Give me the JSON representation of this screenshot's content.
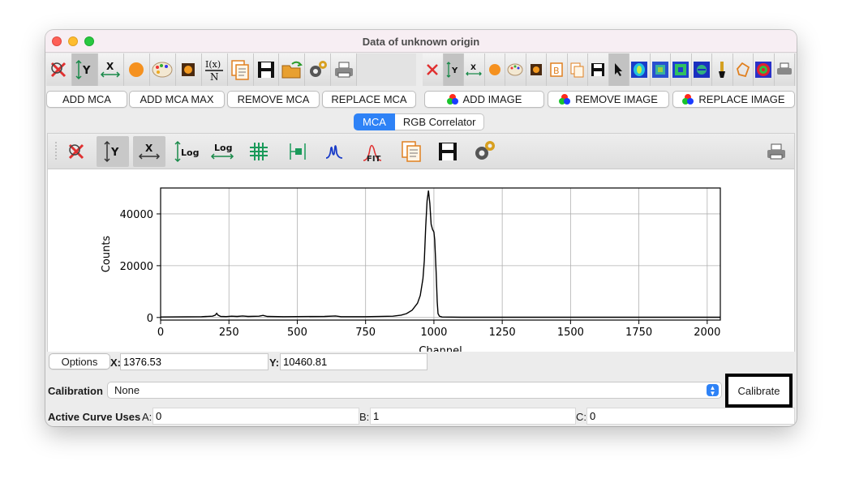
{
  "window": {
    "title": "Data of unknown origin"
  },
  "toolbar_main": {
    "icons": [
      "reset-zoom-icon",
      "autoscale-y-icon",
      "autoscale-x-icon",
      "point-marker-icon",
      "color-palette-icon",
      "image-save-icon",
      "normalize-icon",
      "copy-icon",
      "save-icon",
      "open-folder-icon",
      "settings-icon",
      "print-icon"
    ],
    "normalize_top": "I(x)",
    "normalize_bottom": "N"
  },
  "toolbar_image": {
    "icons": [
      "reset-zoom-icon",
      "autoscale-y-icon",
      "autoscale-x-icon",
      "point-marker-icon",
      "color-palette-icon",
      "image-save-icon",
      "bookmark-icon",
      "copy-icon",
      "save-icon",
      "pointer-icon",
      "colormap-1-icon",
      "colormap-2-icon",
      "colormap-3-icon",
      "colormap-4-icon",
      "brush-icon",
      "polygon-icon",
      "target-icon",
      "print-icon"
    ]
  },
  "buttons": {
    "add_mca": "ADD MCA",
    "add_mca_max": "ADD MCA MAX",
    "remove_mca": "REMOVE MCA",
    "replace_mca": "REPLACE MCA",
    "add_image": "ADD IMAGE",
    "remove_image": "REMOVE IMAGE",
    "replace_image": "REPLACE IMAGE"
  },
  "tabs": [
    {
      "label": "MCA",
      "active": true
    },
    {
      "label": "RGB Correlator",
      "active": false
    }
  ],
  "plot_toolbar": {
    "icons": [
      "reset-zoom-icon",
      "autoscale-y-icon",
      "autoscale-x-icon",
      "log-y-icon",
      "log-x-icon",
      "grid-icon",
      "fit-range-icon",
      "peak-search-icon",
      "fit-icon",
      "copy-icon",
      "save-icon",
      "settings-icon",
      "print-icon"
    ],
    "log_label": "Log",
    "fit_label": "FIT"
  },
  "chart_data": {
    "type": "line",
    "title": "",
    "xlabel": "Channel",
    "ylabel": "Counts",
    "xlim": [
      0,
      2048
    ],
    "ylim": [
      -1000,
      50000
    ],
    "x_ticks": [
      0,
      250,
      500,
      750,
      1000,
      1250,
      1500,
      1750,
      2000
    ],
    "x_tick_labels": [
      "0",
      "250",
      "500",
      "750",
      "1000",
      "1250",
      "1500",
      "1750",
      "2000"
    ],
    "y_ticks": [
      0,
      20000,
      40000
    ],
    "y_tick_labels": [
      "0",
      "20000",
      "40000"
    ],
    "grid": true,
    "series": [
      {
        "color": "#000000",
        "x": [
          0,
          150,
          190,
          200,
          205,
          210,
          220,
          240,
          260,
          280,
          300,
          320,
          360,
          375,
          390,
          450,
          600,
          640,
          660,
          750,
          850,
          880,
          900,
          920,
          940,
          950,
          960,
          965,
          970,
          975,
          980,
          985,
          990,
          995,
          1000,
          1003,
          1008,
          1012,
          1015,
          1020,
          1030,
          1100,
          2048
        ],
        "y": [
          200,
          300,
          500,
          900,
          1600,
          900,
          400,
          350,
          500,
          400,
          600,
          400,
          500,
          800,
          400,
          300,
          400,
          600,
          300,
          300,
          500,
          900,
          1500,
          2800,
          5500,
          8500,
          15000,
          22000,
          35000,
          45000,
          49000,
          44000,
          36000,
          34000,
          33000,
          30000,
          18000,
          6000,
          1500,
          500,
          200,
          100,
          100
        ]
      }
    ]
  },
  "options_button": "Options",
  "coords": {
    "x_label": "X:",
    "x_value": "1376.53",
    "y_label": "Y:",
    "y_value": "10460.81"
  },
  "calibration": {
    "label": "Calibration",
    "value": "None",
    "button": "Calibrate"
  },
  "active_curve": {
    "label": "Active Curve Uses",
    "a_label": "A:",
    "a_value": "0",
    "b_label": "B:",
    "b_value": "1",
    "c_label": "C:",
    "c_value": "0"
  },
  "colors": {
    "accent": "#2e82f6",
    "focus_border": "#000000"
  }
}
